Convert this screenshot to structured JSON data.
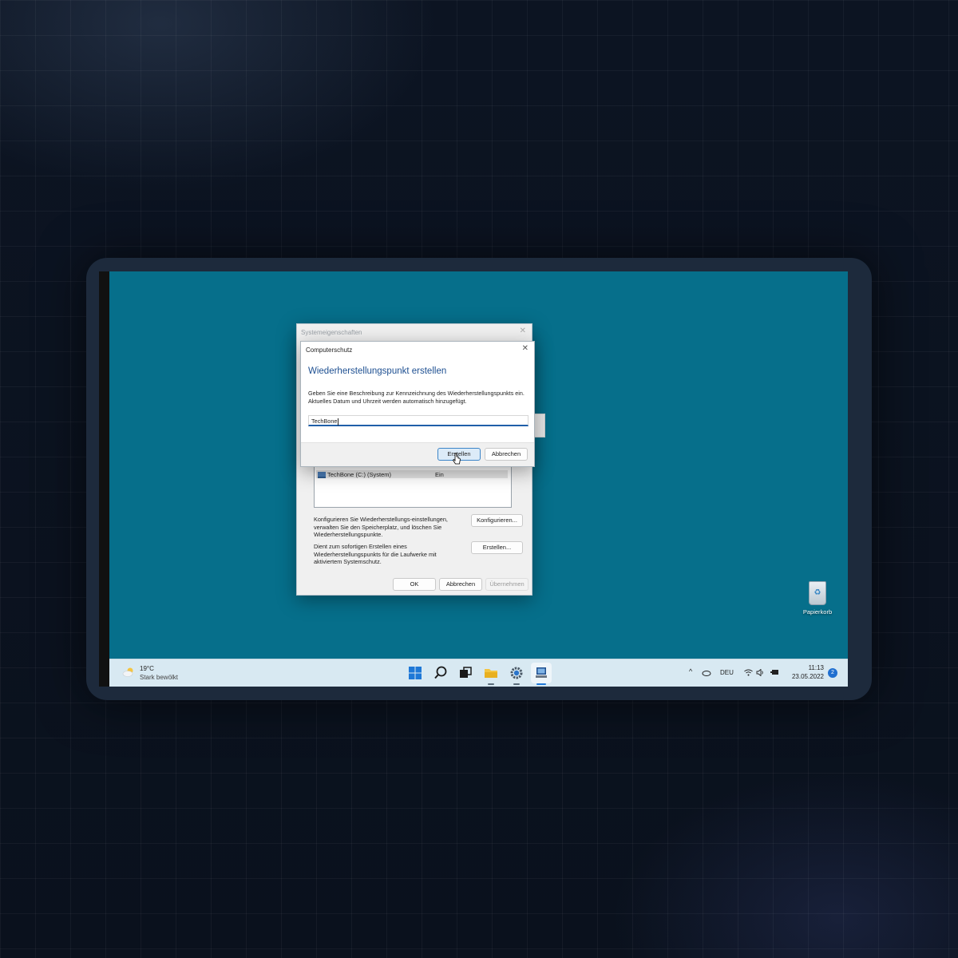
{
  "system_properties": {
    "title": "Systemeigenschaften",
    "drive_row": {
      "name": "TechBone (C:) (System)",
      "state": "Ein"
    },
    "configure_text": "Konfigurieren Sie Wiederherstellungs-einstellungen, verwalten Sie den Speicherplatz, und löschen Sie Wiederherstellungspunkte.",
    "configure_button": "Konfigurieren...",
    "create_text": "Dient zum sofortigen Erstellen eines Wiederherstellungspunkts für die Laufwerke mit aktiviertem Systemschutz.",
    "create_button": "Erstellen...",
    "ok_button": "OK",
    "cancel_button": "Abbrechen",
    "apply_button": "Übernehmen"
  },
  "computerschutz": {
    "title": "Computerschutz",
    "heading": "Wiederherstellungspunkt erstellen",
    "instruction": "Geben Sie eine Beschreibung zur Kennzeichnung des Wiederherstellungspunkts ein. Aktuelles Datum und Uhrzeit werden automatisch hinzugefügt.",
    "input_value": "TechBone",
    "create_button": "Erstellen",
    "cancel_button": "Abbrechen"
  },
  "desktop": {
    "recycle_bin_label": "Papierkorb",
    "background_color": "#066f8b"
  },
  "taskbar": {
    "weather_temp": "19°C",
    "weather_condition": "Stark bewölkt",
    "language": "DEU",
    "time": "11:13",
    "date": "23.05.2022",
    "notification_count": "2",
    "icons": [
      "windows-start-icon",
      "search-icon",
      "task-view-icon",
      "file-explorer-icon",
      "settings-icon",
      "system-properties-icon"
    ]
  },
  "colors": {
    "accent": "#1f5fa9",
    "heading_blue": "#1d4f91",
    "taskbar": "#d8e9f2"
  }
}
